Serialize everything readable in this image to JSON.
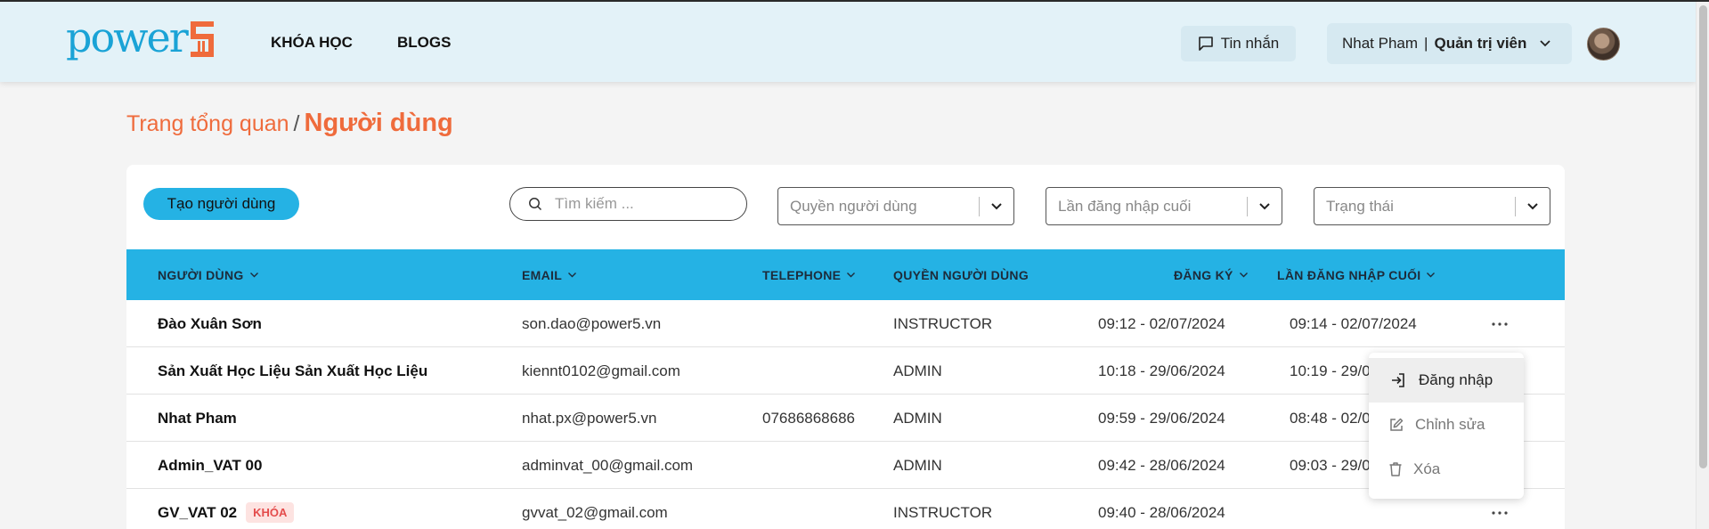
{
  "header": {
    "logo_text": "power",
    "nav": [
      "KHÓA HỌC",
      "BLOGS"
    ],
    "messages_label": "Tin nhắn",
    "user_name": "Nhat Pham",
    "user_separator": "|",
    "user_role": "Quản trị viên"
  },
  "breadcrumb": {
    "parent": "Trang tổng quan",
    "separator": "/",
    "current": "Người dùng"
  },
  "toolbar": {
    "create_label": "Tạo người dùng",
    "search_placeholder": "Tìm kiếm ...",
    "filters": [
      "Quyền người dùng",
      "Lần đăng nhập cuối",
      "Trạng thái"
    ]
  },
  "table": {
    "columns": [
      "NGƯỜI DÙNG",
      "EMAIL",
      "TELEPHONE",
      "QUYỀN NGƯỜI DÙNG",
      "ĐĂNG KÝ",
      "LẦN ĐĂNG NHẬP CUỐI"
    ],
    "rows": [
      {
        "name": "Đào Xuân Sơn",
        "badge": "",
        "email": "son.dao@power5.vn",
        "phone": "",
        "role": "INSTRUCTOR",
        "registered": "09:12 - 02/07/2024",
        "last_login": "09:14 - 02/07/2024",
        "more": "···"
      },
      {
        "name": "Sản Xuất Học Liệu Sản Xuất Học Liệu",
        "badge": "",
        "email": "kiennt0102@gmail.com",
        "phone": "",
        "role": "ADMIN",
        "registered": "10:18 - 29/06/2024",
        "last_login": "10:19 - 29/0",
        "more": ""
      },
      {
        "name": "Nhat Pham",
        "badge": "",
        "email": "nhat.px@power5.vn",
        "phone": "07686868686",
        "role": "ADMIN",
        "registered": "09:59 - 29/06/2024",
        "last_login": "08:48 - 02/0",
        "more": ""
      },
      {
        "name": "Admin_VAT 00",
        "badge": "",
        "email": "adminvat_00@gmail.com",
        "phone": "",
        "role": "ADMIN",
        "registered": "09:42 - 28/06/2024",
        "last_login": "09:03 - 29/0",
        "more": ""
      },
      {
        "name": "GV_VAT 02",
        "badge": "KHÓA",
        "email": "gvvat_02@gmail.com",
        "phone": "",
        "role": "INSTRUCTOR",
        "registered": "09:40 - 28/06/2024",
        "last_login": "",
        "more": "···"
      }
    ]
  },
  "row_menu": {
    "items": [
      "Đăng nhập",
      "Chỉnh sửa",
      "Xóa"
    ],
    "active_index": 0
  },
  "colors": {
    "header_bg": "#e3f2f8",
    "accent_blue": "#25b2e4",
    "accent_orange": "#ef6b3c",
    "lock_badge": "#e44c4c"
  },
  "icons": [
    "chat-icon",
    "chevron-down-icon",
    "search-icon",
    "sort-chevron-icon",
    "more-icon",
    "login-icon",
    "edit-icon",
    "trash-icon"
  ]
}
